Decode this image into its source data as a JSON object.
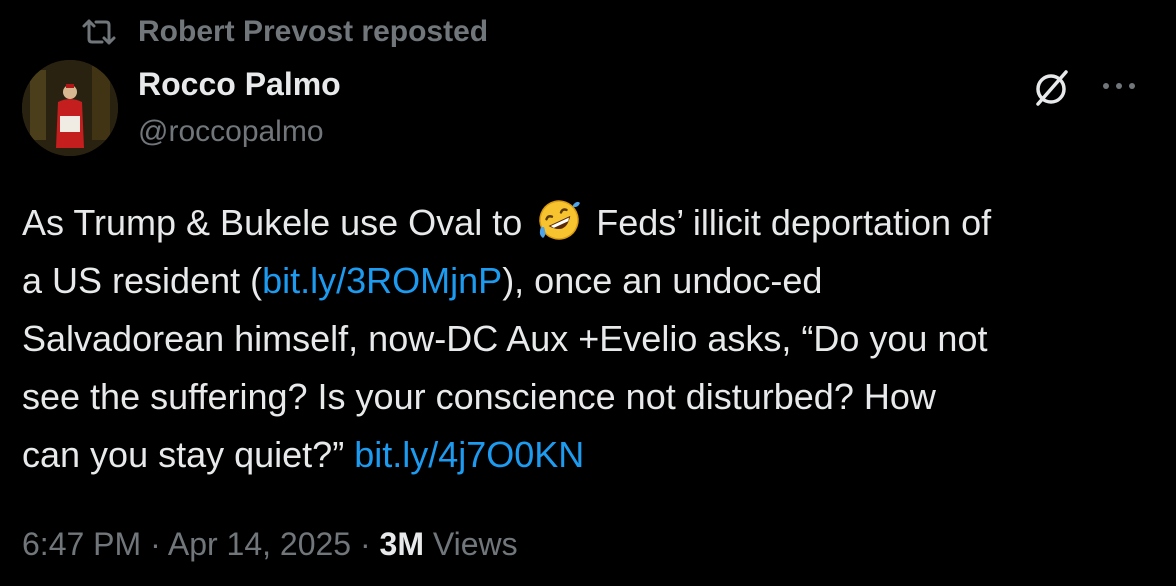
{
  "repost": {
    "text": "Robert Prevost reposted",
    "icon": "repost-icon"
  },
  "author": {
    "name": "Rocco Palmo",
    "handle": "@roccopalmo",
    "avatar_icon": "avatar"
  },
  "actions": {
    "grok_icon": "grok-icon",
    "more_icon": "more-icon"
  },
  "tweet": {
    "line1_a": "As Trump & Bukele use Oval to ",
    "line1_emoji": "rolling-on-floor-laughing-emoji",
    "line1_b": " Feds’ illicit deportation of",
    "line2_a": "a US resident (",
    "line2_link": "bit.ly/3ROMjnP",
    "line2_b": "), once an undoc-ed",
    "line3": "Salvadorean himself, now-DC Aux +Evelio asks, “Do you not",
    "line4": "see the suffering? Is your conscience not disturbed? How",
    "line5_a": "can you stay quiet?” ",
    "line5_link": "bit.ly/4j7O0KN"
  },
  "meta": {
    "time": "6:47 PM",
    "separator1": " · ",
    "date": "Apr 14, 2025",
    "separator2": " · ",
    "views_count": "3M",
    "views_label": " Views"
  },
  "colors": {
    "background": "#000000",
    "text": "#e7e9ea",
    "secondary": "#71767b",
    "link": "#1d9bf0"
  }
}
